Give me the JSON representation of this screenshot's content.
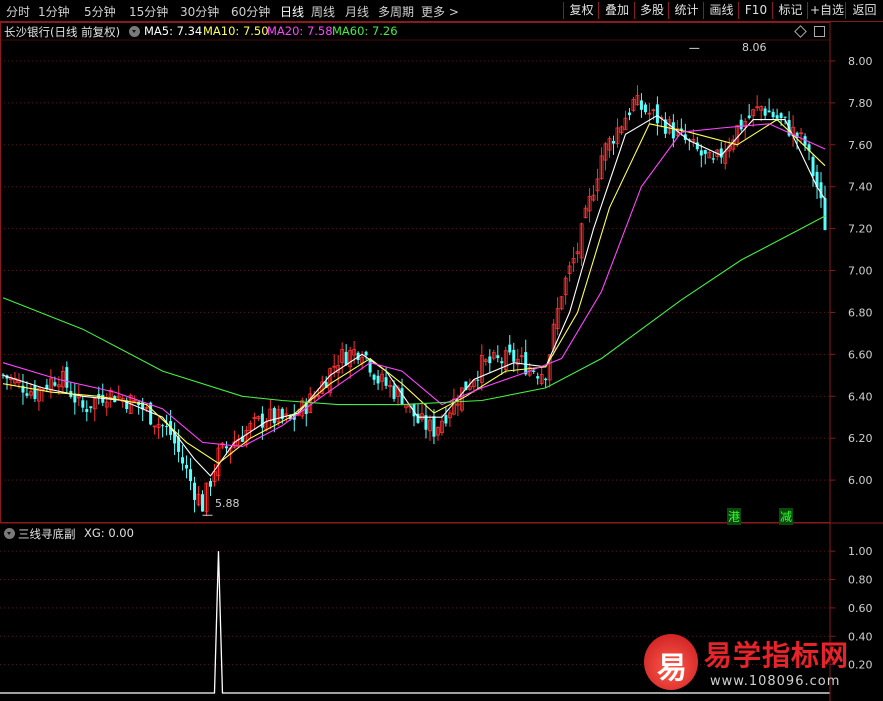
{
  "toolbar": {
    "tabs": [
      "分时",
      "1分钟",
      "5分钟",
      "15分钟",
      "30分钟",
      "60分钟",
      "日线",
      "周线",
      "月线",
      "多周期",
      "更多 >"
    ],
    "active_tab": "日线",
    "right_buttons": [
      "复权",
      "叠加",
      "多股",
      "统计",
      "画线",
      "F10",
      "标记",
      "+自选",
      "返回"
    ]
  },
  "main_panel": {
    "title": "长沙银行(日线 前复权)",
    "ma_legend": [
      {
        "label": "MA5: 7.34",
        "color": "#ffffff"
      },
      {
        "label": "MA10: 7.50",
        "color": "#ffff55"
      },
      {
        "label": "MA20: 7.58",
        "color": "#ff44ff"
      },
      {
        "label": "MA60: 7.26",
        "color": "#44ee44"
      }
    ],
    "high_label": "8.06",
    "low_label": "5.88",
    "markers": [
      "港",
      "减"
    ]
  },
  "sub_panel": {
    "title": "三线寻底副",
    "legend": "XG: 0.00"
  },
  "watermark": {
    "logo_char": "易",
    "site_name": "易学指标网",
    "url": "www.108096.com"
  },
  "colors": {
    "up": "#ff3232",
    "down": "#54ffff",
    "ma5": "#ffffff",
    "ma10": "#ffff55",
    "ma20": "#ff44ff",
    "ma60": "#44ee44",
    "border": "#8b1a1a"
  },
  "chart_data": [
    {
      "type": "candlestick",
      "title": "长沙银行(日线 前复权)",
      "ylim": [
        5.8,
        8.1
      ],
      "y_ticks": [
        "8.00",
        "7.80",
        "7.60",
        "7.40",
        "7.20",
        "7.00",
        "6.80",
        "6.60",
        "6.40",
        "6.20",
        "6.00"
      ],
      "x_count": 140,
      "close_path": [
        [
          0,
          6.5
        ],
        [
          8,
          6.42
        ],
        [
          14,
          6.5
        ],
        [
          20,
          6.34
        ],
        [
          26,
          6.42
        ],
        [
          34,
          6.36
        ],
        [
          42,
          6.22
        ],
        [
          48,
          5.95
        ],
        [
          50,
          5.88
        ],
        [
          54,
          6.12
        ],
        [
          60,
          6.22
        ],
        [
          66,
          6.3
        ],
        [
          72,
          6.28
        ],
        [
          78,
          6.4
        ],
        [
          84,
          6.58
        ],
        [
          90,
          6.63
        ],
        [
          94,
          6.48
        ],
        [
          100,
          6.4
        ],
        [
          104,
          6.28
        ],
        [
          108,
          6.24
        ],
        [
          114,
          6.4
        ],
        [
          120,
          6.55
        ],
        [
          128,
          6.58
        ],
        [
          134,
          6.52
        ],
        [
          136,
          6.52
        ],
        [
          140,
          6.9
        ],
        [
          144,
          7.1
        ],
        [
          150,
          7.55
        ],
        [
          158,
          7.8
        ],
        [
          166,
          7.7
        ],
        [
          172,
          7.6
        ],
        [
          178,
          7.5
        ],
        [
          184,
          7.68
        ],
        [
          190,
          7.78
        ],
        [
          196,
          7.7
        ],
        [
          201,
          7.6
        ],
        [
          204,
          7.4
        ],
        [
          206,
          7.22
        ]
      ],
      "ma_series": [
        {
          "name": "MA5",
          "color": "#ffffff",
          "points": [
            [
              0,
              6.5
            ],
            [
              10,
              6.44
            ],
            [
              20,
              6.4
            ],
            [
              30,
              6.38
            ],
            [
              40,
              6.3
            ],
            [
              48,
              6.1
            ],
            [
              52,
              6.02
            ],
            [
              58,
              6.18
            ],
            [
              66,
              6.28
            ],
            [
              74,
              6.32
            ],
            [
              82,
              6.5
            ],
            [
              90,
              6.6
            ],
            [
              96,
              6.52
            ],
            [
              104,
              6.3
            ],
            [
              110,
              6.3
            ],
            [
              118,
              6.48
            ],
            [
              128,
              6.56
            ],
            [
              136,
              6.54
            ],
            [
              142,
              6.8
            ],
            [
              148,
              7.2
            ],
            [
              156,
              7.65
            ],
            [
              164,
              7.74
            ],
            [
              172,
              7.62
            ],
            [
              180,
              7.55
            ],
            [
              188,
              7.72
            ],
            [
              196,
              7.72
            ],
            [
              204,
              7.4
            ],
            [
              206,
              7.34
            ]
          ]
        },
        {
          "name": "MA10",
          "color": "#ffff55",
          "points": [
            [
              0,
              6.46
            ],
            [
              12,
              6.42
            ],
            [
              24,
              6.4
            ],
            [
              36,
              6.36
            ],
            [
              46,
              6.18
            ],
            [
              54,
              6.08
            ],
            [
              62,
              6.2
            ],
            [
              72,
              6.3
            ],
            [
              82,
              6.46
            ],
            [
              92,
              6.58
            ],
            [
              100,
              6.46
            ],
            [
              108,
              6.32
            ],
            [
              116,
              6.4
            ],
            [
              126,
              6.52
            ],
            [
              136,
              6.54
            ],
            [
              144,
              6.8
            ],
            [
              152,
              7.3
            ],
            [
              162,
              7.7
            ],
            [
              172,
              7.66
            ],
            [
              184,
              7.6
            ],
            [
              194,
              7.72
            ],
            [
              206,
              7.5
            ]
          ]
        },
        {
          "name": "MA20",
          "color": "#ff44ff",
          "points": [
            [
              0,
              6.56
            ],
            [
              14,
              6.48
            ],
            [
              28,
              6.42
            ],
            [
              40,
              6.34
            ],
            [
              50,
              6.18
            ],
            [
              60,
              6.16
            ],
            [
              70,
              6.26
            ],
            [
              80,
              6.4
            ],
            [
              92,
              6.56
            ],
            [
              100,
              6.52
            ],
            [
              110,
              6.36
            ],
            [
              120,
              6.44
            ],
            [
              132,
              6.52
            ],
            [
              140,
              6.58
            ],
            [
              150,
              6.9
            ],
            [
              160,
              7.4
            ],
            [
              170,
              7.66
            ],
            [
              180,
              7.68
            ],
            [
              192,
              7.7
            ],
            [
              206,
              7.58
            ]
          ]
        },
        {
          "name": "MA60",
          "color": "#44ee44",
          "points": [
            [
              0,
              6.87
            ],
            [
              20,
              6.72
            ],
            [
              40,
              6.52
            ],
            [
              60,
              6.4
            ],
            [
              70,
              6.38
            ],
            [
              84,
              6.36
            ],
            [
              100,
              6.36
            ],
            [
              120,
              6.38
            ],
            [
              136,
              6.44
            ],
            [
              150,
              6.58
            ],
            [
              170,
              6.86
            ],
            [
              185,
              7.05
            ],
            [
              200,
              7.2
            ],
            [
              206,
              7.26
            ]
          ]
        }
      ]
    },
    {
      "type": "line",
      "title": "三线寻底副",
      "series_name": "XG",
      "ylim": [
        0,
        1.1
      ],
      "y_ticks": [
        "1.00",
        "0.80",
        "0.60",
        "0.40",
        "0.20"
      ],
      "spike_index": 54,
      "spike_value": 1.0,
      "baseline": 0.0
    }
  ]
}
